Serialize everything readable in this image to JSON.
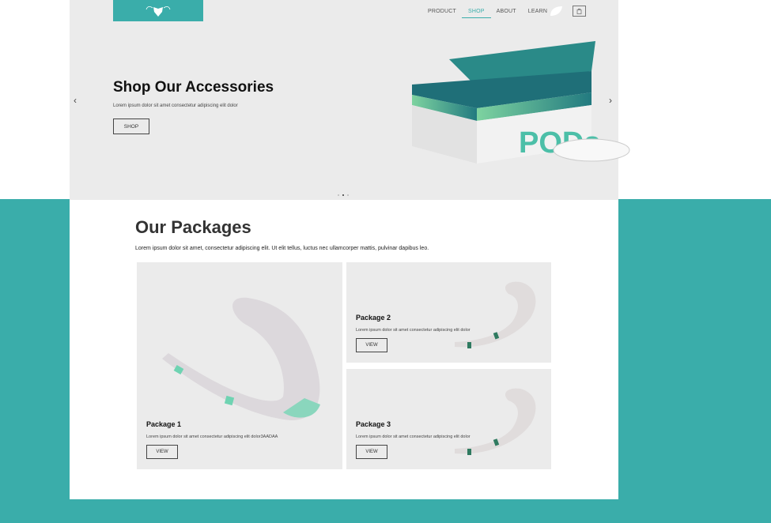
{
  "nav": {
    "items": [
      "PRODUCT",
      "SHOP",
      "ABOUT",
      "LEARN"
    ],
    "active": "SHOP"
  },
  "hero": {
    "title": "Shop Our Accessories",
    "text": "Lorem ipsum dolor sit amet consectetur adipiscing elit dolor",
    "button": "SHOP",
    "prev": "‹",
    "next": "›",
    "image_label": "PODs"
  },
  "packages": {
    "title": "Our Packages",
    "description": "Lorem ipsum dolor sit amet, consectetur adipiscing elit. Ut elit tellus, luctus nec ullamcorper mattis, pulvinar dapibus leo.",
    "items": [
      {
        "title": "Package 1",
        "text": "Lorem ipsum dolor sit amet consectetur adipiscing elit dolor3AADAA",
        "button": "VIEW"
      },
      {
        "title": "Package 2",
        "text": "Lorem ipsum dolor sit amet consectetur adipiscing elit dolor",
        "button": "VIEW"
      },
      {
        "title": "Package 3",
        "text": "Lorem ipsum dolor sit amet consectetur adipiscing elit dolor",
        "button": "VIEW"
      }
    ]
  },
  "colors": {
    "accent": "#3AADAA",
    "hero_bg": "#EBEBEB"
  }
}
